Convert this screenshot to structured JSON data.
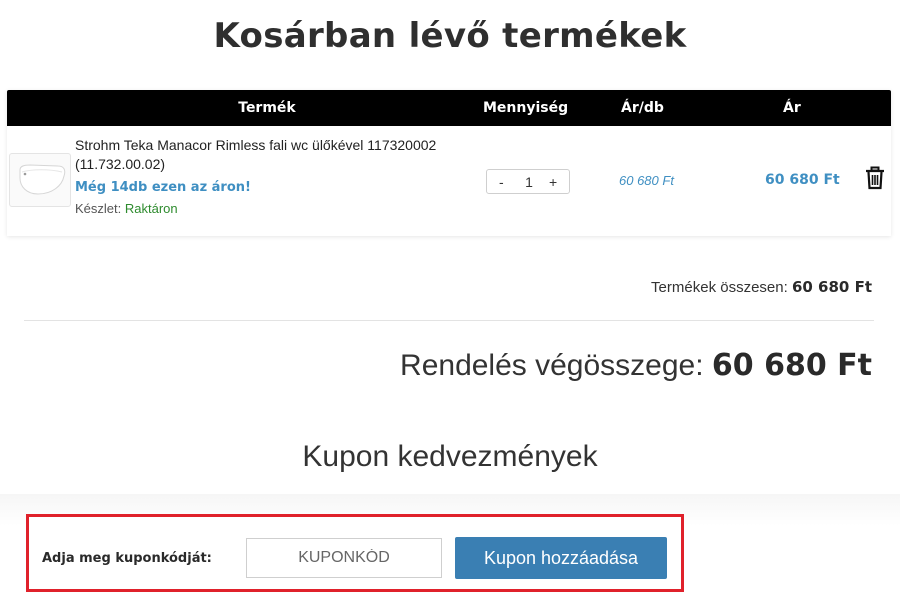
{
  "page": {
    "title": "Kosárban lévő termékek"
  },
  "cart": {
    "headers": {
      "product": "Termék",
      "quantity": "Mennyiség",
      "unit_price": "Ár/db",
      "price": "Ár"
    },
    "items": [
      {
        "name": "Strohm Teka Manacor Rimless fali wc ülőkével 117320002 (11.732.00.02)",
        "stock_note": "Még 14db ezen az áron!",
        "availability_label": "Készlet:",
        "availability_value": "Raktáron",
        "quantity": "1",
        "qty_minus": "-",
        "qty_plus": "+",
        "unit_price": "60 680 Ft",
        "price": "60 680 Ft",
        "thumbnail_icon": "wall-toilet-image",
        "delete_icon": "trash-icon"
      }
    ]
  },
  "totals": {
    "subtotal_label": "Termékek összesen:",
    "subtotal_value": "60 680 Ft",
    "grand_total_label": "Rendelés végösszege:",
    "grand_total_value": "60 680 Ft"
  },
  "coupon": {
    "title": "Kupon kedvezmények",
    "label": "Adja meg kuponkódját:",
    "input_placeholder": "KUPONKÓD",
    "input_value": "",
    "button_label": "Kupon hozzáadása"
  },
  "colors": {
    "accent": "#3f8fc2",
    "button": "#3a7fb3",
    "header_bg": "#000000",
    "in_stock": "#2e8b2e",
    "highlight_border": "#e0212b"
  }
}
